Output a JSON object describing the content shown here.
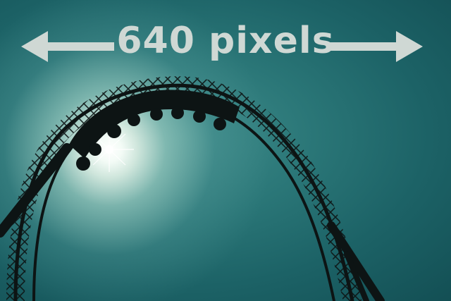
{
  "caption": {
    "text": "640 pixels",
    "color": "#cfd8d4"
  },
  "arrows": {
    "left": "left-arrow-icon",
    "right": "right-arrow-icon",
    "color": "#cfd8d4"
  },
  "photo": {
    "sky_colors": [
      "#2a7677",
      "#134f54"
    ],
    "sun_color": "#ffffff",
    "silhouette_color": "#0d1414"
  }
}
